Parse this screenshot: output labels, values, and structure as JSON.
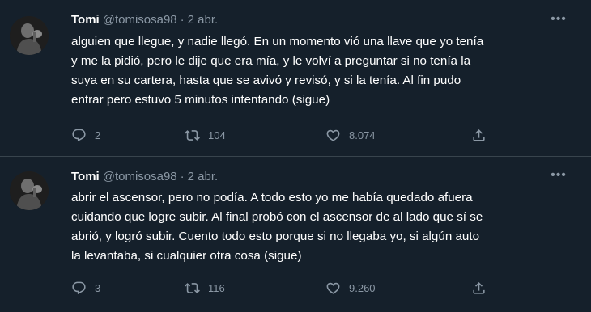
{
  "theme": {
    "background": "#15202b",
    "text": "#ffffff",
    "muted": "#8b98a5",
    "divider": "#38444d"
  },
  "tweets": [
    {
      "display_name": "Tomi",
      "handle": "@tomisosa98",
      "separator": "·",
      "date": "2 abr.",
      "more": "•••",
      "text": "alguien que llegue, y nadie llegó. En un momento vió una llave que yo tenía\ny me la pidió, pero le dije que era mía, y le volví a preguntar si no tenía la\nsuya en su cartera, hasta que se avivó y revisó, y si la tenía. Al fin pudo\nentrar pero estuvo 5 minutos intentando (sigue)",
      "replies": "2",
      "retweets": "104",
      "likes": "8.074",
      "icons": {
        "reply": "reply-icon",
        "retweet": "retweet-icon",
        "like": "heart-icon",
        "share": "share-icon"
      }
    },
    {
      "display_name": "Tomi",
      "handle": "@tomisosa98",
      "separator": "·",
      "date": "2 abr.",
      "more": "•••",
      "text": "abrir el ascensor, pero no podía. A todo esto yo me había quedado afuera\ncuidando que logre subir. Al final probó con el ascensor de al lado que sí se\nabrió, y logró subir. Cuento todo esto porque si no llegaba yo, si algún auto\nla levantaba, si cualquier otra cosa (sigue)",
      "replies": "3",
      "retweets": "116",
      "likes": "9.260",
      "icons": {
        "reply": "reply-icon",
        "retweet": "retweet-icon",
        "like": "heart-icon",
        "share": "share-icon"
      }
    }
  ]
}
